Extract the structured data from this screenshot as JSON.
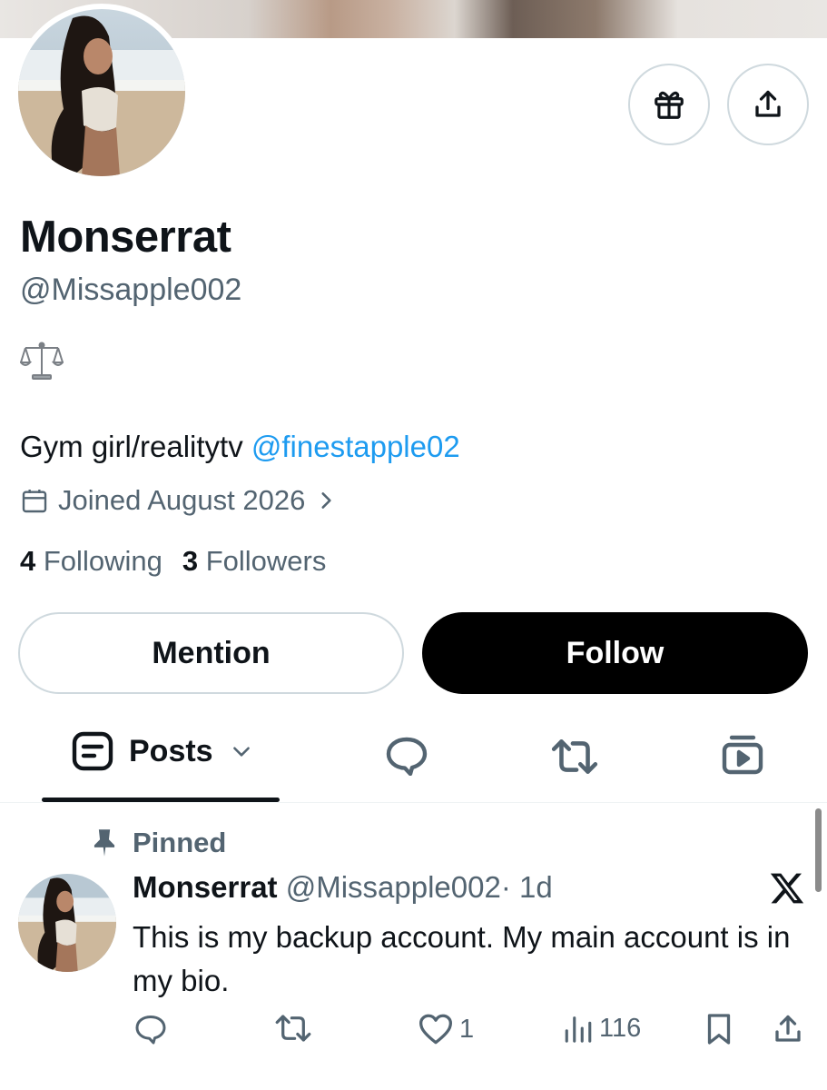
{
  "profile": {
    "name": "Monserrat",
    "handle": "@Missapple002",
    "emoji": "⚖️",
    "bio_text": "Gym girl/realitytv",
    "bio_link": "@finestapple02",
    "joined": "Joined August 2026",
    "following_count": "4",
    "following_label": "Following",
    "followers_count": "3",
    "followers_label": "Followers"
  },
  "header_icons": {
    "gift": "gift-icon",
    "share": "share-icon"
  },
  "buttons": {
    "mention": "Mention",
    "follow": "Follow"
  },
  "tabs": {
    "posts_label": "Posts",
    "icons": [
      "posts-icon",
      "replies-icon",
      "reposts-icon",
      "media-icon"
    ]
  },
  "pinned_post": {
    "pinned_label": "Pinned",
    "author_name": "Monserrat",
    "author_handle": "@Missapple002",
    "time": "· 1d",
    "text": "This is my backup account. My main account is in my bio.",
    "replies": "",
    "reposts": "",
    "likes": "1",
    "views": "116"
  },
  "colors": {
    "text_primary": "#0f1419",
    "text_secondary": "#536471",
    "link": "#1d9bf0",
    "follow_bg": "#000000",
    "border": "#cfd9de"
  }
}
